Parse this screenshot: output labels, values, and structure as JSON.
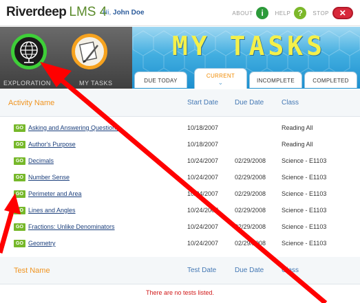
{
  "brand": {
    "name": "Riverdeep",
    "product": "LMS 4"
  },
  "greeting": {
    "prefix": "Hi,",
    "user": "John Doe"
  },
  "top_links": {
    "about": "ABOUT",
    "help": "HELP",
    "stop": "STOP"
  },
  "header": {
    "title": "MY TASKS",
    "nav": [
      {
        "label": "EXPLORATION",
        "icon": "globe-icon"
      },
      {
        "label": "MY TASKS",
        "icon": "pencil-paper-icon"
      }
    ]
  },
  "tabs": [
    {
      "label": "DUE TODAY",
      "active": false
    },
    {
      "label": "CURRENT",
      "active": true
    },
    {
      "label": "INCOMPLETE",
      "active": false
    },
    {
      "label": "COMPLETED",
      "active": false
    }
  ],
  "activities": {
    "headers": {
      "name": "Activity Name",
      "start": "Start Date",
      "due": "Due Date",
      "class": "Class"
    },
    "go_label": "GO",
    "rows": [
      {
        "name": "Asking and Answering Questions",
        "start": "10/18/2007",
        "due": "",
        "class": "Reading All"
      },
      {
        "name": "Author's Purpose",
        "start": "10/18/2007",
        "due": "",
        "class": "Reading All"
      },
      {
        "name": "Decimals",
        "start": "10/24/2007",
        "due": "02/29/2008",
        "class": "Science - E1103"
      },
      {
        "name": "Number Sense",
        "start": "10/24/2007",
        "due": "02/29/2008",
        "class": "Science - E1103"
      },
      {
        "name": "Perimeter and Area",
        "start": "10/24/2007",
        "due": "02/29/2008",
        "class": "Science - E1103"
      },
      {
        "name": "Lines and Angles",
        "start": "10/24/2007",
        "due": "02/29/2008",
        "class": "Science - E1103"
      },
      {
        "name": "Fractions: Unlike Denominators",
        "start": "10/24/2007",
        "due": "02/29/2008",
        "class": "Science - E1103"
      },
      {
        "name": "Geometry",
        "start": "10/24/2007",
        "due": "02/29/2008",
        "class": "Science - E1103"
      }
    ]
  },
  "tests": {
    "headers": {
      "name": "Test Name",
      "date": "Test Date",
      "due": "Due Date",
      "class": "Class"
    },
    "empty_message": "There are no tests listed."
  },
  "colors": {
    "accent_orange": "#f09420",
    "header_blue": "#42aee0",
    "title_yellow": "#f4f04a",
    "go_green": "#76b82a",
    "annotation_red": "#ff0000"
  }
}
